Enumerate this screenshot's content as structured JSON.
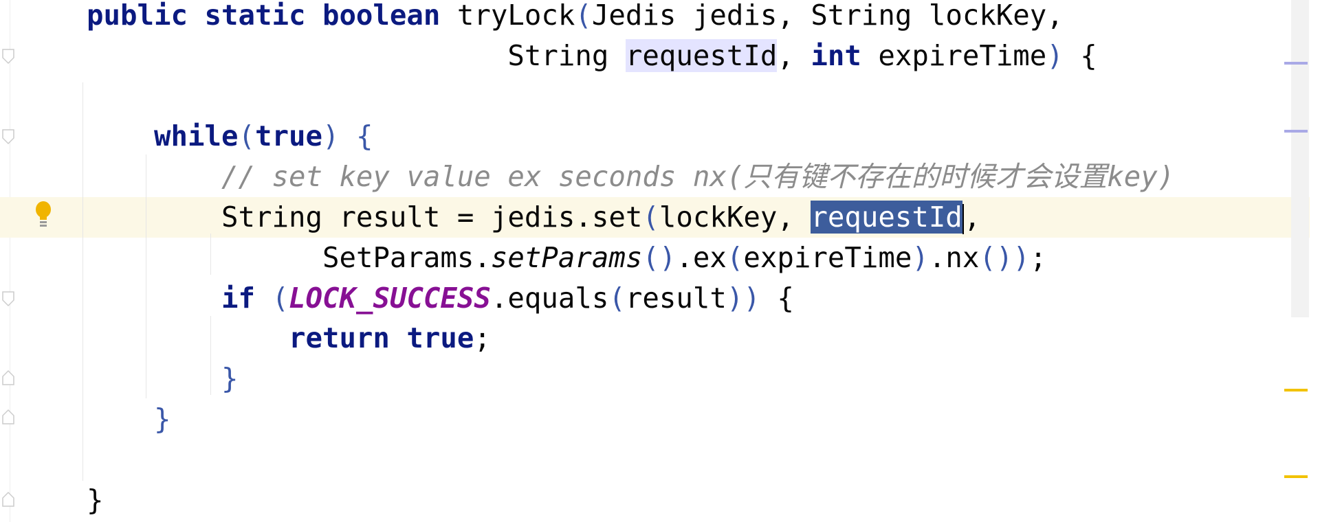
{
  "editor": {
    "language": "java",
    "current_line_index": 5,
    "lines": [
      [
        [
          "public static boolean ",
          "kw"
        ],
        [
          "tryLock",
          ""
        ],
        [
          "(",
          "par"
        ],
        [
          "Jedis jedis, String lockKey,",
          ""
        ]
      ],
      [
        [
          "                         ",
          ""
        ],
        [
          "String ",
          ""
        ],
        [
          "requestId",
          "paramhl"
        ],
        [
          ", ",
          ""
        ],
        [
          "int ",
          "kw"
        ],
        [
          "expireTime",
          ""
        ],
        [
          ")",
          "par"
        ],
        [
          " {",
          ""
        ]
      ],
      [],
      [
        [
          "    ",
          ""
        ],
        [
          "while",
          "kw"
        ],
        [
          "(",
          "par"
        ],
        [
          "true",
          "kw"
        ],
        [
          ")",
          "par"
        ],
        [
          " ",
          ""
        ],
        [
          "{",
          "par"
        ]
      ],
      [
        [
          "        ",
          ""
        ],
        [
          "// set key value ex seconds nx(只有键不存在的时候才会设置key)",
          "cm"
        ]
      ],
      [
        [
          "        ",
          ""
        ],
        [
          "String result = jedis.set",
          ""
        ],
        [
          "(",
          "par"
        ],
        [
          "lockKey, ",
          ""
        ],
        [
          "requestId",
          "sel"
        ],
        [
          "",
          "caret"
        ],
        [
          ",",
          ""
        ]
      ],
      [
        [
          "              ",
          ""
        ],
        [
          "SetParams.",
          ""
        ],
        [
          "setParams",
          "st"
        ],
        [
          "()",
          "par"
        ],
        [
          ".ex",
          ""
        ],
        [
          "(",
          "par"
        ],
        [
          "expireTime",
          ""
        ],
        [
          ")",
          "par"
        ],
        [
          ".nx",
          ""
        ],
        [
          "()",
          "par"
        ],
        [
          ")",
          "par"
        ],
        [
          ";",
          ""
        ]
      ],
      [
        [
          "        ",
          ""
        ],
        [
          "if ",
          "kw"
        ],
        [
          "(",
          "par"
        ],
        [
          "LOCK_SUCCESS",
          "const"
        ],
        [
          ".equals",
          ""
        ],
        [
          "(",
          "par"
        ],
        [
          "result",
          ""
        ],
        [
          "))",
          "par"
        ],
        [
          " {",
          ""
        ]
      ],
      [
        [
          "            ",
          ""
        ],
        [
          "return true",
          "kw"
        ],
        [
          ";",
          ""
        ]
      ],
      [
        [
          "        ",
          ""
        ],
        [
          "}",
          "par"
        ]
      ],
      [
        [
          "    ",
          ""
        ],
        [
          "}",
          "par"
        ]
      ],
      [],
      [
        [
          "}",
          ""
        ]
      ]
    ]
  },
  "gutter": {
    "intention_icon": "lightbulb-icon",
    "intention_color": "#f0b400"
  },
  "scrollbar": {
    "markers": [
      {
        "kind": "usage",
        "color": "#a9a9e6"
      },
      {
        "kind": "usage",
        "color": "#a9a9e6"
      },
      {
        "kind": "warning",
        "color": "#f2c200"
      },
      {
        "kind": "warning",
        "color": "#f2c200"
      }
    ]
  }
}
